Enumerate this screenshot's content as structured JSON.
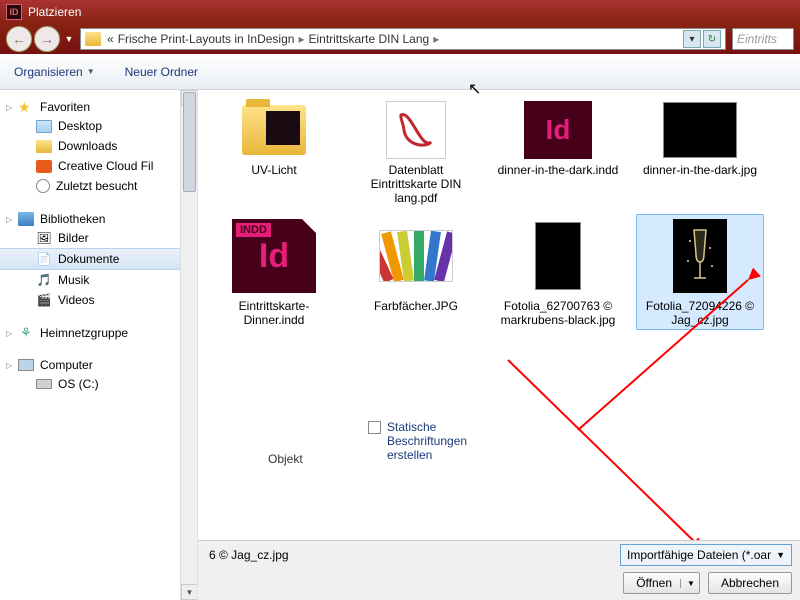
{
  "title": "Platzieren",
  "breadcrumb": {
    "prefix": "«",
    "p1": "Frische Print-Layouts in InDesign",
    "p2": "Eintrittskarte DIN Lang"
  },
  "search_placeholder": "Eintritts",
  "toolbar": {
    "organize": "Organisieren",
    "newfolder": "Neuer Ordner"
  },
  "sidebar": {
    "favoriten": "Favoriten",
    "desktop": "Desktop",
    "downloads": "Downloads",
    "creative": "Creative Cloud Fil",
    "zuletzt": "Zuletzt besucht",
    "bibliotheken": "Bibliotheken",
    "bilder": "Bilder",
    "dokumente": "Dokumente",
    "musik": "Musik",
    "videos": "Videos",
    "heimnetz": "Heimnetzgruppe",
    "computer": "Computer",
    "os": "OS (C:)"
  },
  "files": {
    "uvlicht": "UV-Licht",
    "datenblatt": "Datenblatt Eintrittskarte DIN lang.pdf",
    "dinnerindd": "dinner-in-the-dark.indd",
    "dinnerjpg": "dinner-in-the-dark.jpg",
    "karteindd": "Eintrittskarte-Dinner.indd",
    "farb": "Farbfächer.JPG",
    "fot1": "Fotolia_62700763 © markrubens-black.jpg",
    "fot2": "Fotolia_72094226 © Jag_cz.jpg"
  },
  "indd_tag": "INDD",
  "indd_id": "Id",
  "checkbox_label": "Statische Beschriftungen erstellen",
  "objekt_label": "Objekt",
  "filename": "6 © Jag_cz.jpg",
  "filetype": "Importfähige Dateien (*.oar",
  "btn_open": "Öffnen",
  "btn_cancel": "Abbrechen"
}
